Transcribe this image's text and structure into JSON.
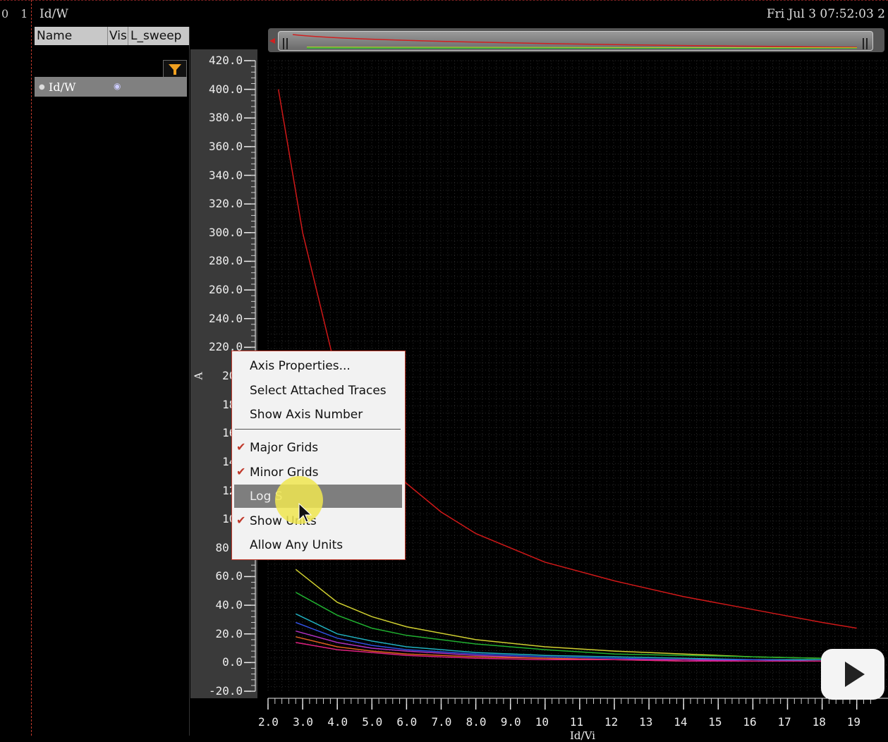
{
  "window": {
    "top_left_numbers": "0 1",
    "title": "Id/W",
    "datetime": "Fri Jul 3 07:52:03 2"
  },
  "browser": {
    "columns": [
      "Name",
      "Vis",
      "L_sweep"
    ],
    "rows": [
      {
        "name": "Id/W"
      }
    ],
    "icons": [
      "filter-icon",
      "eye-icon",
      "expand-icon"
    ]
  },
  "menu": {
    "items": [
      {
        "label": "Axis Properties...",
        "checked": false
      },
      {
        "label": "Select Attached Traces",
        "checked": false
      },
      {
        "label": "Show Axis Number",
        "checked": false
      },
      {
        "label": "Major Grids",
        "checked": true
      },
      {
        "label": "Minor Grids",
        "checked": true
      },
      {
        "label": "Log S",
        "checked": false,
        "highlighted": true
      },
      {
        "label": "Show Units",
        "checked": true
      },
      {
        "label": "Allow Any Units",
        "checked": false
      }
    ],
    "check_glyph": "✔"
  },
  "colors": {
    "menu_check": "#c0392b",
    "highlight": "#7e7e7e",
    "cursor_halo": "#f0e650"
  },
  "chart_data": {
    "type": "line",
    "ylabel": "A",
    "xlabel": "Id/Vi",
    "ylim": [
      -20,
      420
    ],
    "xlim": [
      2,
      19
    ],
    "grid": true,
    "yticks": [
      "420.0",
      "400.0",
      "380.0",
      "360.0",
      "340.0",
      "320.0",
      "300.0",
      "280.0",
      "260.0",
      "240.0",
      "220.0",
      "200",
      "180",
      "160",
      "140",
      "120",
      "100",
      "80.0",
      "60.0",
      "40.0",
      "20.0",
      "0.0",
      "-20.0"
    ],
    "xticks": [
      "2.0",
      "3.0",
      "4.0",
      "5.0",
      "6.0",
      "7.0",
      "8.0",
      "9.0",
      "10",
      "11",
      "12",
      "13",
      "14",
      "15",
      "16",
      "17",
      "18",
      "19"
    ],
    "series": [
      {
        "color": "#d01818",
        "x": [
          2.3,
          3.0,
          4.0,
          5.0,
          6.0,
          7.0,
          8.0,
          10,
          12,
          14,
          16,
          18,
          19
        ],
        "y": [
          400,
          300,
          200,
          150,
          125,
          105,
          90,
          70,
          57,
          46,
          37,
          28,
          24
        ]
      },
      {
        "color": "#d0d030",
        "x": [
          2.8,
          4.0,
          5.0,
          6.0,
          8.0,
          10,
          12,
          14,
          16,
          18,
          19
        ],
        "y": [
          65,
          42,
          32,
          25,
          16,
          11,
          8,
          6,
          4,
          3,
          3
        ]
      },
      {
        "color": "#20b030",
        "x": [
          2.8,
          4.0,
          5.0,
          6.0,
          8.0,
          10,
          12,
          14,
          16,
          18,
          19
        ],
        "y": [
          49,
          33,
          24,
          19,
          13,
          9,
          6,
          5,
          4,
          3,
          2
        ]
      },
      {
        "color": "#20b0c0",
        "x": [
          2.8,
          4.0,
          5.0,
          6.0,
          8.0,
          10,
          12,
          14,
          16,
          18,
          19
        ],
        "y": [
          34,
          20,
          15,
          11,
          7,
          5,
          4,
          3,
          2,
          2,
          1
        ]
      },
      {
        "color": "#3050e0",
        "x": [
          2.8,
          4.0,
          5.0,
          6.0,
          8.0,
          10,
          12,
          14,
          16,
          18,
          19
        ],
        "y": [
          28,
          17,
          12,
          9,
          6,
          4,
          3,
          2,
          2,
          1,
          1
        ]
      },
      {
        "color": "#b030c0",
        "x": [
          2.8,
          4.0,
          5.0,
          6.0,
          8.0,
          10,
          12,
          14,
          16,
          18,
          19
        ],
        "y": [
          22,
          14,
          10,
          8,
          5,
          3,
          2,
          2,
          1,
          1,
          1
        ]
      },
      {
        "color": "#e06020",
        "x": [
          2.8,
          4.0,
          5.0,
          6.0,
          8.0,
          10,
          12,
          14,
          16,
          18,
          19
        ],
        "y": [
          18,
          11,
          8,
          6,
          4,
          3,
          2,
          1,
          1,
          1,
          1
        ]
      },
      {
        "color": "#e02080",
        "x": [
          2.8,
          4.0,
          5.0,
          6.0,
          8.0,
          10,
          12,
          14,
          16,
          18,
          19
        ],
        "y": [
          14,
          9,
          7,
          5,
          3,
          2,
          2,
          1,
          1,
          1,
          0
        ]
      }
    ]
  }
}
